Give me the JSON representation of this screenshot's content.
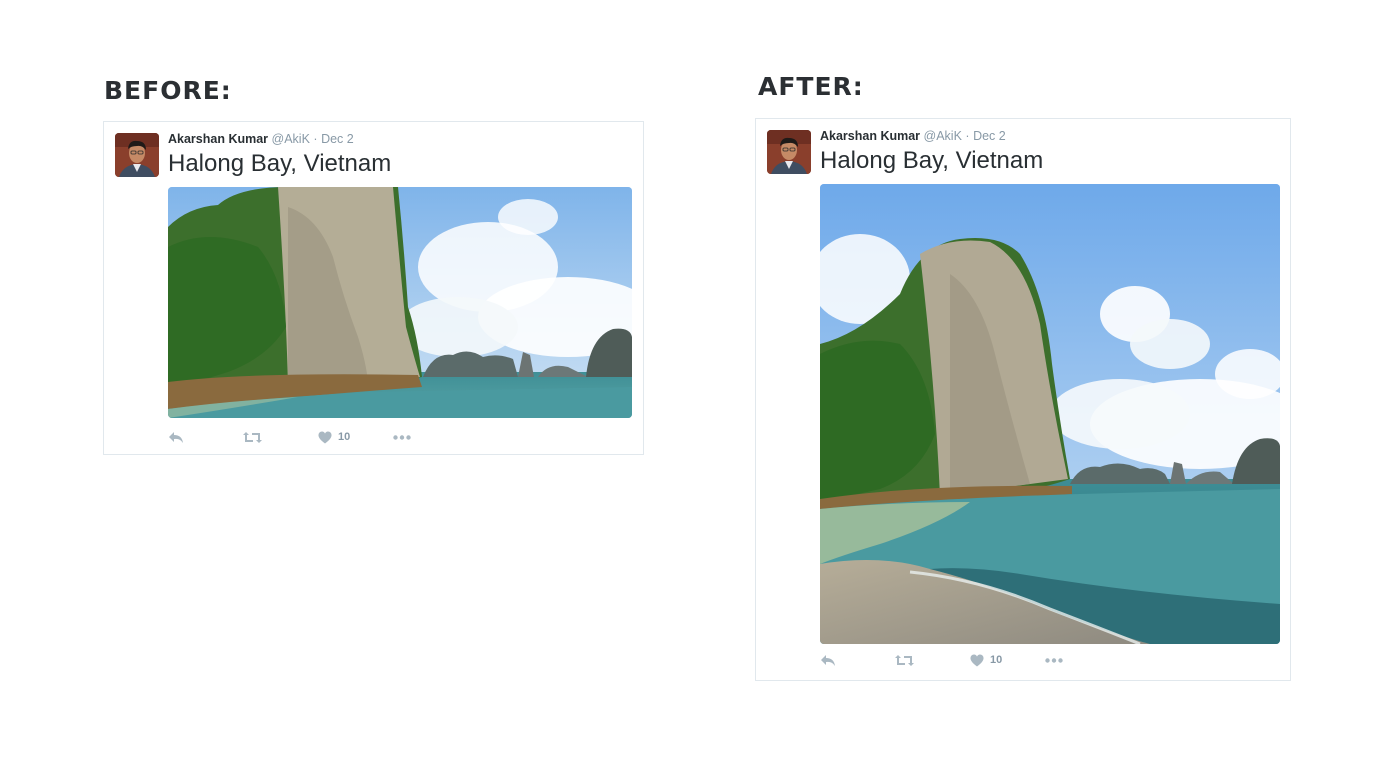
{
  "labels": {
    "before": "BEFORE:",
    "after": "AFTER:"
  },
  "tweet": {
    "author_name": "Akarshan Kumar",
    "handle": "@AkiK",
    "separator": "·",
    "date": "Dec 2",
    "text": "Halong Bay, Vietnam",
    "like_count": "10"
  },
  "icons": {
    "reply": "reply-icon",
    "retweet": "retweet-icon",
    "like": "heart-icon",
    "more": "more-icon"
  },
  "colors": {
    "heading": "#2b2f33",
    "action_icon": "#aab8c2",
    "meta_text": "#8899a6",
    "border": "#e1e8ed"
  }
}
